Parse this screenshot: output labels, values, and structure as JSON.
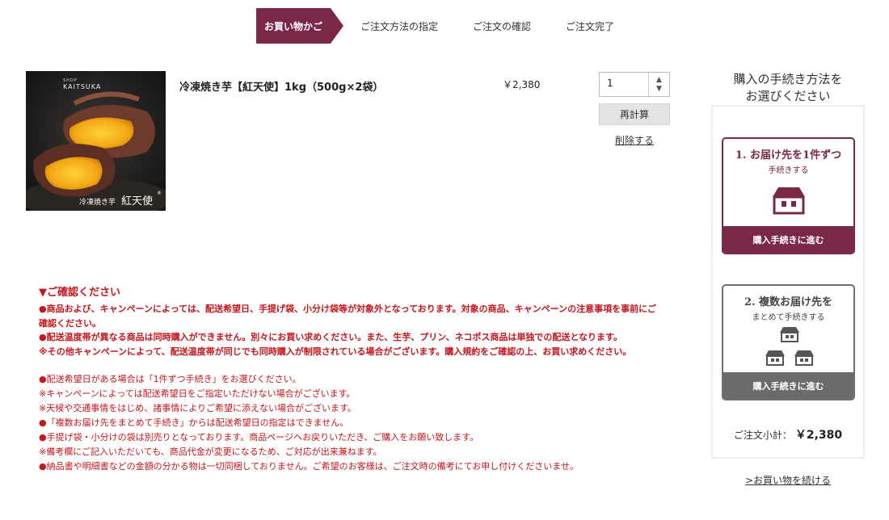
{
  "steps": [
    {
      "label": "お買い物かご",
      "active": true
    },
    {
      "label": "ご注文方法の指定",
      "active": false
    },
    {
      "label": "ご注文の確認",
      "active": false
    },
    {
      "label": "ご注文完了",
      "active": false
    }
  ],
  "product": {
    "image": {
      "brand_small": "SHOP",
      "brand": "KAITSUKA",
      "caption_small": "冷凍焼き芋",
      "caption_large": "紅天使",
      "registered_mark": "®"
    },
    "name": "冷凍焼き芋【紅天使】1kg（500g×2袋）",
    "price": "￥2,380",
    "quantity": "1",
    "recalc_label": "再計算",
    "delete_label": "削除する"
  },
  "notice": {
    "title": "▼ご確認ください",
    "bold_lines": [
      "●商品および、キャンペーンによっては、配送希望日、手提げ袋、小分け袋等が対象外となっております。対象の商品、キャンペーンの注意事項を事前にご確認ください。",
      "●配送温度帯が異なる商品は同時購入ができません。別々にお買い求めください。また、生芋、プリン、ネコポス商品は単独での配送となります。",
      "※その他キャンペーンによって、配送温度帯が同じでも同時購入が制限されている場合がございます。購入規約をご確認の上、お買い求めください。"
    ],
    "lines": [
      "●配送希望日がある場合は「1件ずつ手続き」をお選びください。",
      "※キャンペーンによっては配送希望日をご指定いただけない場合がございます。",
      "※天候や交通事情をはじめ、諸事情によりご希望に添えない場合がございます。",
      "●「複数お届け先をまとめて手続き」からは配送希望日の指定はできません。",
      "●手提げ袋・小分けの袋は別売りとなっております。商品ページへお戻りいただき、ご購入をお願い致します。",
      "※備考欄にご記入いただいても、商品代金が変更になるため、ご対応が出来兼ねます。",
      "●納品書や明細書などの金額の分かる物は一切同梱しておりません。ご希望のお客様は、ご注文時の備考にてお申し付けくださいませ。"
    ]
  },
  "sidebar": {
    "heading_line1": "購入の手続き方法を",
    "heading_line2": "お選びください",
    "option1": {
      "title": "1. お届け先を1件ずつ",
      "subtitle": "手続きする",
      "button": "購入手続きに進む",
      "icon": "single-house-icon",
      "color": "#7b2749"
    },
    "option2": {
      "title": "2. 複数お届け先を",
      "subtitle": "まとめて手続きする",
      "button": "購入手続きに進む",
      "icon": "multiple-houses-icon",
      "color": "#6b6b6b"
    },
    "subtotal_label": "ご注文小計：",
    "subtotal_value": "￥2,380",
    "continue_label": ">お買い物を続ける"
  }
}
